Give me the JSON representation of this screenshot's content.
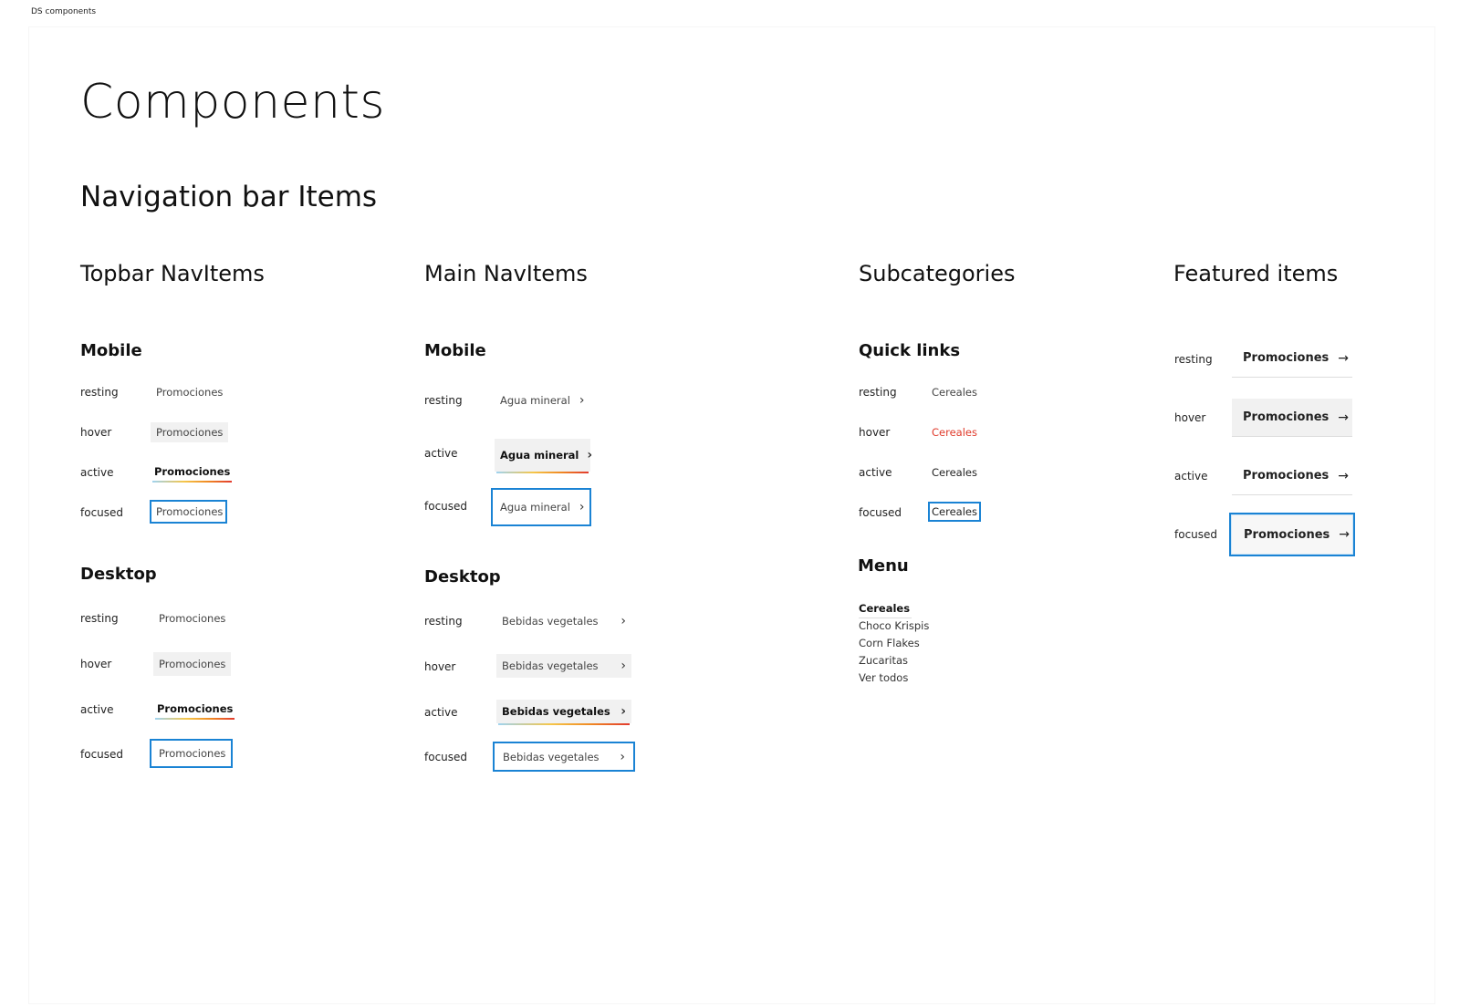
{
  "frame_label": "DS components",
  "page_title": "Components",
  "section_title": "Navigation bar Items",
  "columns": {
    "topbar": "Topbar NavItems",
    "main": "Main NavItems",
    "subcategories": "Subcategories",
    "featured": "Featured items"
  },
  "groups": {
    "topbar_mobile": "Mobile",
    "topbar_desktop": "Desktop",
    "main_mobile": "Mobile",
    "main_desktop": "Desktop",
    "quick_links": "Quick links",
    "menu": "Menu"
  },
  "states": {
    "resting": "resting",
    "hover": "hover",
    "active": "active",
    "focused": "focused"
  },
  "items": {
    "promociones": "Promociones",
    "agua_mineral": "Agua mineral",
    "bebidas_vegetales": "Bebidas vegetales",
    "cereales": "Cereales"
  },
  "icons": {
    "chevron": "chevron-right-icon",
    "arrow": "arrow-right-icon"
  },
  "colors": {
    "focus": "#1a83d4",
    "hover_text": "#e03a2b",
    "hover_bg": "#f1f1f1"
  },
  "menu_items": [
    "Cereales",
    "Choco Krispis",
    "Corn Flakes",
    "Zucaritas",
    "Ver todos"
  ]
}
